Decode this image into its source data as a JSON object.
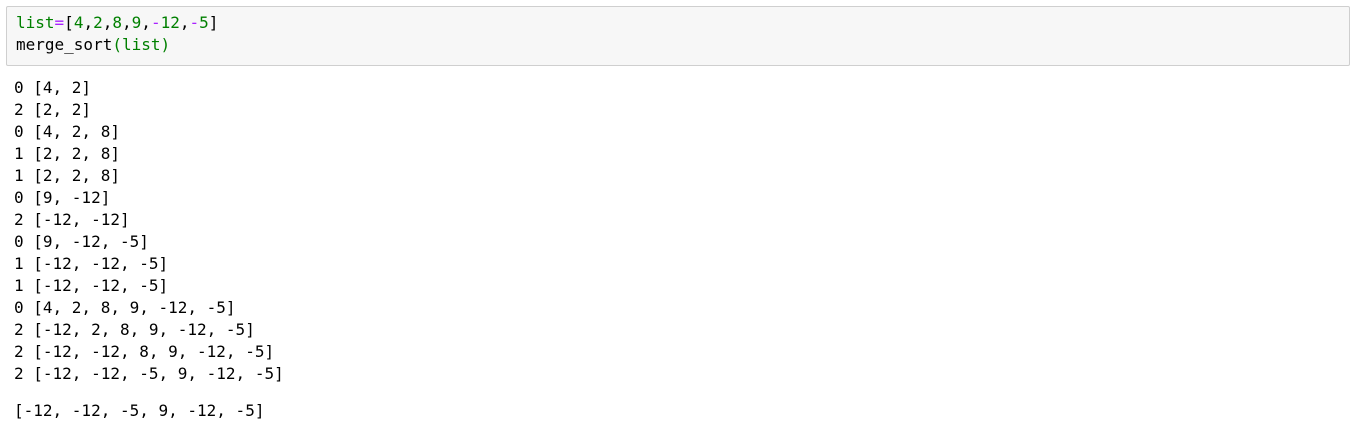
{
  "input": {
    "line1": {
      "var": "list",
      "assign": "=",
      "open": "[",
      "items": [
        "4",
        "2",
        "8",
        "9",
        "-12",
        "-5"
      ],
      "close": "]"
    },
    "line2": {
      "func": "merge_sort",
      "open_paren": "(",
      "arg": "list",
      "close_paren": ")"
    }
  },
  "output": {
    "stream": [
      "0 [4, 2]",
      "2 [2, 2]",
      "0 [4, 2, 8]",
      "1 [2, 2, 8]",
      "1 [2, 2, 8]",
      "0 [9, -12]",
      "2 [-12, -12]",
      "0 [9, -12, -5]",
      "1 [-12, -12, -5]",
      "1 [-12, -12, -5]",
      "0 [4, 2, 8, 9, -12, -5]",
      "2 [-12, 2, 8, 9, -12, -5]",
      "2 [-12, -12, 8, 9, -12, -5]",
      "2 [-12, -12, -5, 9, -12, -5]"
    ],
    "result": "[-12, -12, -5, 9, -12, -5]"
  }
}
